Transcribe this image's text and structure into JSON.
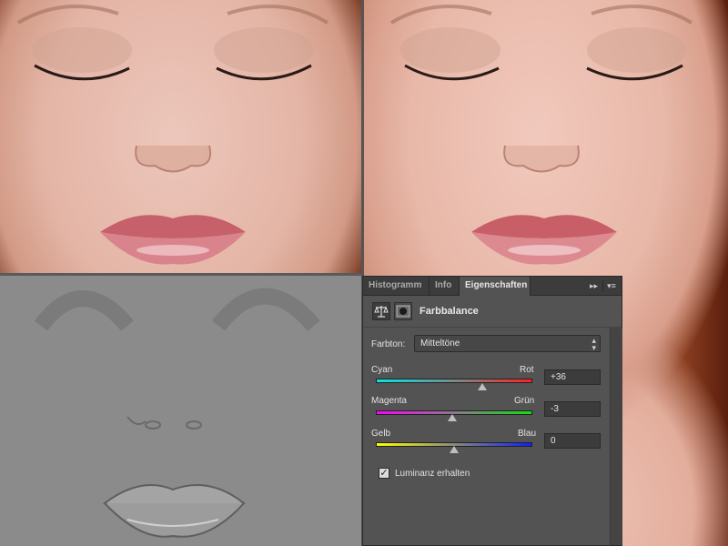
{
  "panel": {
    "tabs": [
      "Histogramm",
      "Info",
      "Eigenschaften"
    ],
    "collapse_icon": "double-chevron-right-icon",
    "menu_icon": "panel-menu-icon",
    "adjustment_icon": "balance-scale-icon",
    "mask_icon": "layer-mask-icon",
    "title": "Farbbalance",
    "tone_label": "Farbton:",
    "tone_value": "Mitteltöne",
    "sliders": [
      {
        "left_label": "Cyan",
        "right_label": "Rot",
        "value": "+36",
        "position": 0.68
      },
      {
        "left_label": "Magenta",
        "right_label": "Grün",
        "value": "-3",
        "position": 0.49
      },
      {
        "left_label": "Gelb",
        "right_label": "Blau",
        "value": "0",
        "position": 0.5
      }
    ],
    "luminance_label": "Luminanz erhalten",
    "luminance_checked": true
  }
}
